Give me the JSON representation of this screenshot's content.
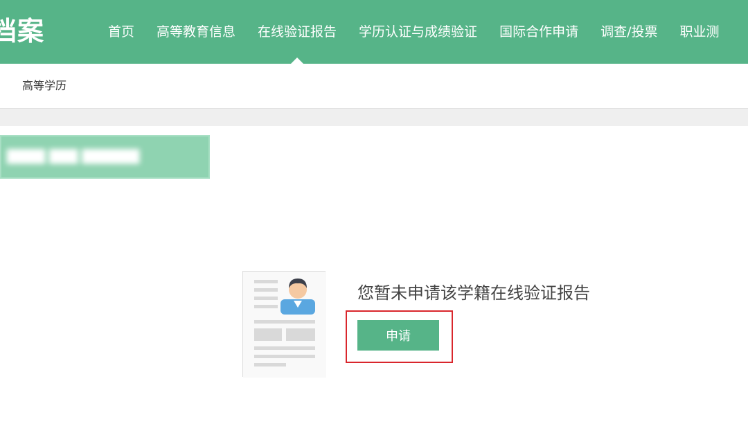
{
  "logo": {
    "text": "档案"
  },
  "nav": {
    "items": [
      {
        "label": "首页"
      },
      {
        "label": "高等教育信息"
      },
      {
        "label": "在线验证报告"
      },
      {
        "label": "学历认证与成绩验证"
      },
      {
        "label": "国际合作申请"
      },
      {
        "label": "调查/投票"
      },
      {
        "label": "职业测"
      }
    ],
    "active_index": 2
  },
  "subnav": {
    "tab": "高等学历"
  },
  "blurred_record": {
    "text": "████ ███ ██████"
  },
  "empty_state": {
    "message": "您暂未申请该学籍在线验证报告",
    "apply_button": "申请"
  },
  "colors": {
    "brand_green": "#56b488",
    "highlight_red": "#d9262c"
  },
  "icons": {
    "document": "document-avatar-icon"
  }
}
